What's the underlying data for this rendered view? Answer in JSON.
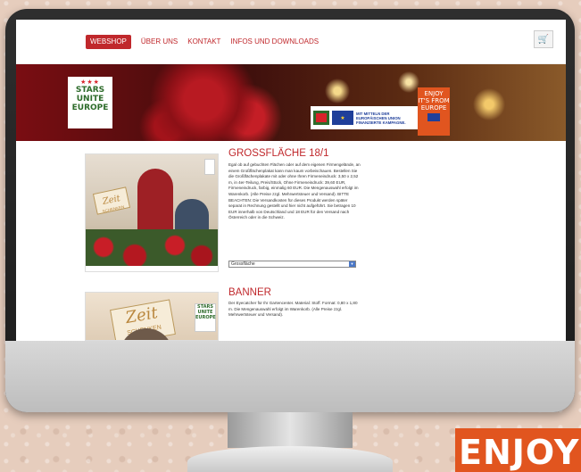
{
  "nav": {
    "items": [
      "WEBSHOP",
      "ÜBER UNS",
      "KONTAKT",
      "INFOS UND DOWNLOADS"
    ],
    "active_index": 0
  },
  "banner": {
    "logo_lines": [
      "STARS",
      "UNITE",
      "EUROPE"
    ],
    "eu_text": [
      "MIT MITTELN DER",
      "EUROPÄISCHEN UNION",
      "FINANZIERTE KAMPAGNE."
    ],
    "enjoy_lines": [
      "ENJOY",
      "IT'S FROM",
      "EUROPE"
    ]
  },
  "products": [
    {
      "title": "GROSSFLÄCHE 18/1",
      "image_tag": {
        "word": "Zeit",
        "sub": "SCHENKEN"
      },
      "description": "Egal ob auf gebuchten Flächen oder auf dem eigenen Firmengelände, an einem Großflächenplakat kann man kaum vorbeischauen. Bestellen Sie die Großflächenplakate mit oder ohne Ihren Firmeneindruck: 3,50 x 2,52 m, in 4er-Teilung, Preis/Stück, Ohne Firmeneindruck: 39,60 EUR, Firmeneindruck, farbig, einmalig 60 EUR. Die Mengenauswahl erfolgt im Warenkorb. (Alle Preise zzgl. Mehrwertsteuer und Versand). BITTE BEACHTEN: Die Versandkosten für dieses Produkt werden später separat in Rechnung gestellt und hier nicht aufgeführt. Sie betragen 10 EUR innerhalb von Deutschland und 18 EUR für den Versand nach Österreich oder in die Schweiz.",
      "select_value": "Grossfläche"
    },
    {
      "title": "BANNER",
      "image_tag": {
        "word": "Zeit",
        "sub": "SCHENKEN"
      },
      "logo_lines": [
        "STARS",
        "UNITE",
        "EUROPE"
      ],
      "description": "Der Eyecatcher für Ihr Gartencenter. Material: Stoff. Format: 0,80 x 1,80 m. Die Mengenauswahl erfolgt im Warenkorb. (Alle Preise zzgl. Mehrwertsteuer und Versand)."
    }
  ],
  "corner_sign": "ENJOY",
  "colors": {
    "accent": "#c0282c",
    "enjoy_orange": "#e1551f",
    "eu_blue": "#1f3f9a"
  },
  "icons": {
    "cart": "cart-icon"
  }
}
